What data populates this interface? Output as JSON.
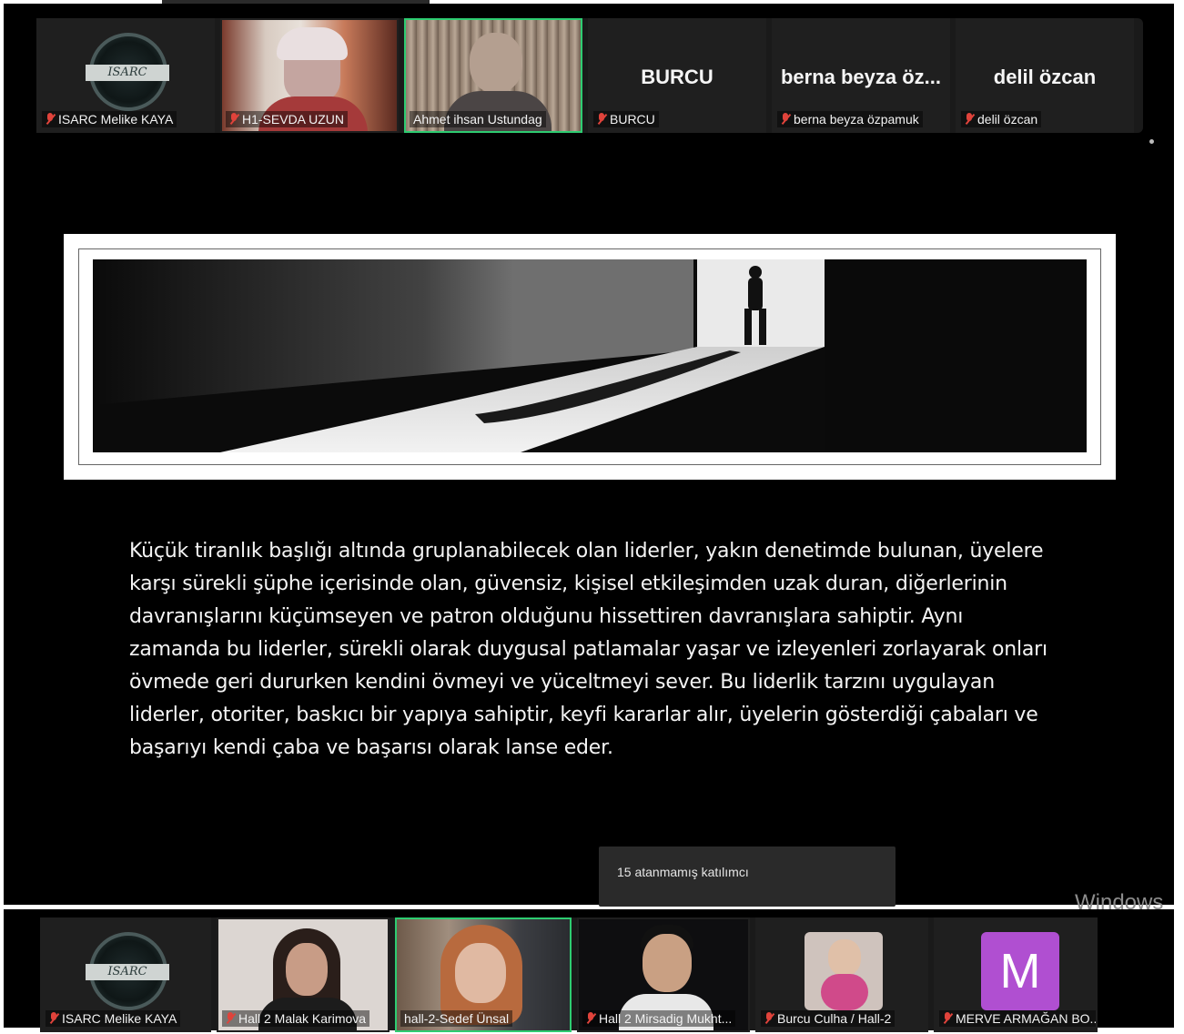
{
  "top_strip": {
    "tiles": [
      {
        "name": "ISARC Melike KAYA",
        "type": "logo",
        "logo_text": "ISARC"
      },
      {
        "name": "H1-SEVDA UZUN",
        "type": "video"
      },
      {
        "name": "Ahmet ihsan Ustundag",
        "type": "video",
        "active": true
      },
      {
        "name": "BURCU",
        "display": "BURCU",
        "type": "name"
      },
      {
        "name": "berna beyza özpamuk",
        "display": "berna beyza öz...",
        "type": "name"
      },
      {
        "name": "delil özcan",
        "display": "delil özcan",
        "type": "name"
      }
    ]
  },
  "slide": {
    "paragraph": "Küçük tiranlık başlığı altında gruplanabilecek olan liderler, yakın denetimde bulunan, üyelere karşı sürekli şüphe içerisinde olan, güvensiz, kişisel etkileşimden uzak duran, diğerlerinin davranışlarını küçümseyen ve patron olduğunu hissettiren davranışlara sahiptir. Aynı zamanda bu liderler, sürekli olarak duygusal patlamalar yaşar ve izleyenleri zorlayarak onları övmede geri dururken kendini övmeyi ve yüceltmeyi sever. Bu liderlik tarzını uygulayan liderler, otoriter, baskıcı bir yapıya sahiptir, keyfi kararlar alır, üyelerin gösterdiği çabaları ve başarıyı kendi çaba ve başarısı olarak lanse eder."
  },
  "popup": {
    "text": "15 atanmamış katılımcı"
  },
  "watermark": "Windows",
  "bottom_strip": {
    "tiles": [
      {
        "name": "ISARC Melike KAYA",
        "type": "logo",
        "logo_text": "ISARC"
      },
      {
        "name": "Hall 2 Malak Karimova",
        "type": "video"
      },
      {
        "name": "hall-2-Sedef Ünsal",
        "type": "video",
        "active": true
      },
      {
        "name": "Hall 2 Mirsadig Mukht...",
        "type": "video"
      },
      {
        "name": "Burcu Culha / Hall-2",
        "type": "photo"
      },
      {
        "name": "MERVE ARMAĞAN BO...",
        "type": "avatar",
        "initial": "M"
      }
    ]
  },
  "colors": {
    "active_border": "#2ecc71",
    "mic_off": "#e0433b",
    "avatar_bg": "#b04fd1"
  }
}
